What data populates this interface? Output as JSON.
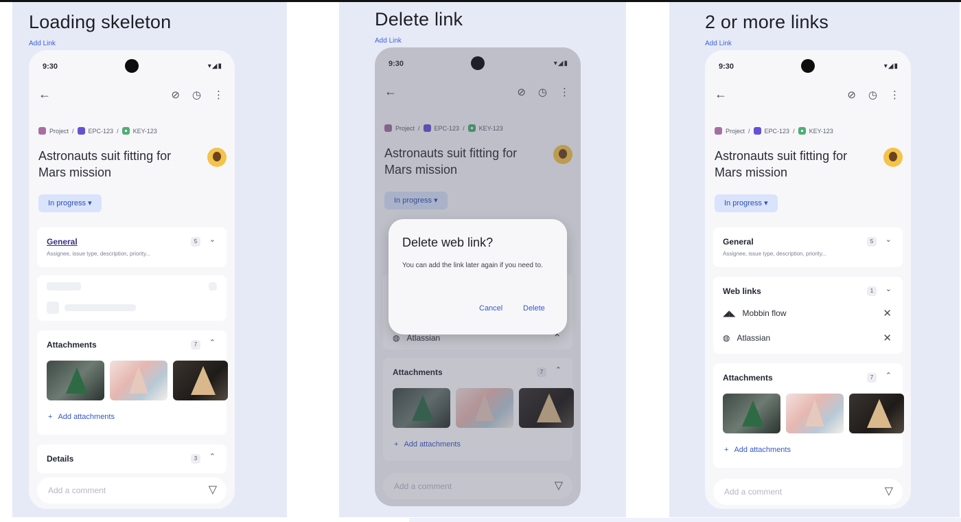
{
  "panels": [
    {
      "heading": "Loading skeleton",
      "add_link": "Add Link",
      "phone": {
        "time": "9:30",
        "sys_icons": "▾◢▮",
        "crumbs": [
          "Project",
          "EPC-123",
          "KEY-123"
        ],
        "title": "Astronauts suit fitting for Mars mission",
        "status": "In progress",
        "general": {
          "title": "General",
          "subtitle": "Assignee, issue type, description, priority...",
          "count": "5"
        },
        "attachments": {
          "title": "Attachments",
          "count": "7",
          "add": "Add attachments"
        },
        "details": {
          "title": "Details",
          "count": "3"
        },
        "comment_placeholder": "Add a comment"
      }
    },
    {
      "heading": "Delete link",
      "add_link": "Add Link",
      "phone": {
        "time": "9:30",
        "sys_icons": "▾◢▮",
        "crumbs": [
          "Project",
          "EPC-123",
          "KEY-123"
        ],
        "title": "Astronauts suit fitting for Mars mission",
        "status": "In progress",
        "hidden_link": "Atlassian",
        "attachments": {
          "title": "Attachments",
          "count": "7",
          "add": "Add attachments"
        },
        "comment_placeholder": "Add a comment",
        "dialog": {
          "title": "Delete web link?",
          "body": "You can add the link later again if you need to.",
          "cancel": "Cancel",
          "delete": "Delete"
        }
      }
    },
    {
      "heading": "2 or more links",
      "add_link": "Add Link",
      "phone": {
        "time": "9:30",
        "sys_icons": "▾◢▮",
        "crumbs": [
          "Project",
          "EPC-123",
          "KEY-123"
        ],
        "title": "Astronauts suit fitting for Mars mission",
        "status": "In progress",
        "general": {
          "title": "General",
          "subtitle": "Assignee, issue type, description, priority...",
          "count": "5"
        },
        "web_links": {
          "title": "Web links",
          "count": "1",
          "items": [
            "Mobbin flow",
            "Atlassian"
          ]
        },
        "attachments": {
          "title": "Attachments",
          "count": "7",
          "add": "Add attachments"
        },
        "comment_placeholder": "Add a comment"
      }
    }
  ],
  "colors": {
    "panel_bg": "#e6eaf7",
    "accent": "#3557c7",
    "status_chip": "#d9e3fb"
  }
}
